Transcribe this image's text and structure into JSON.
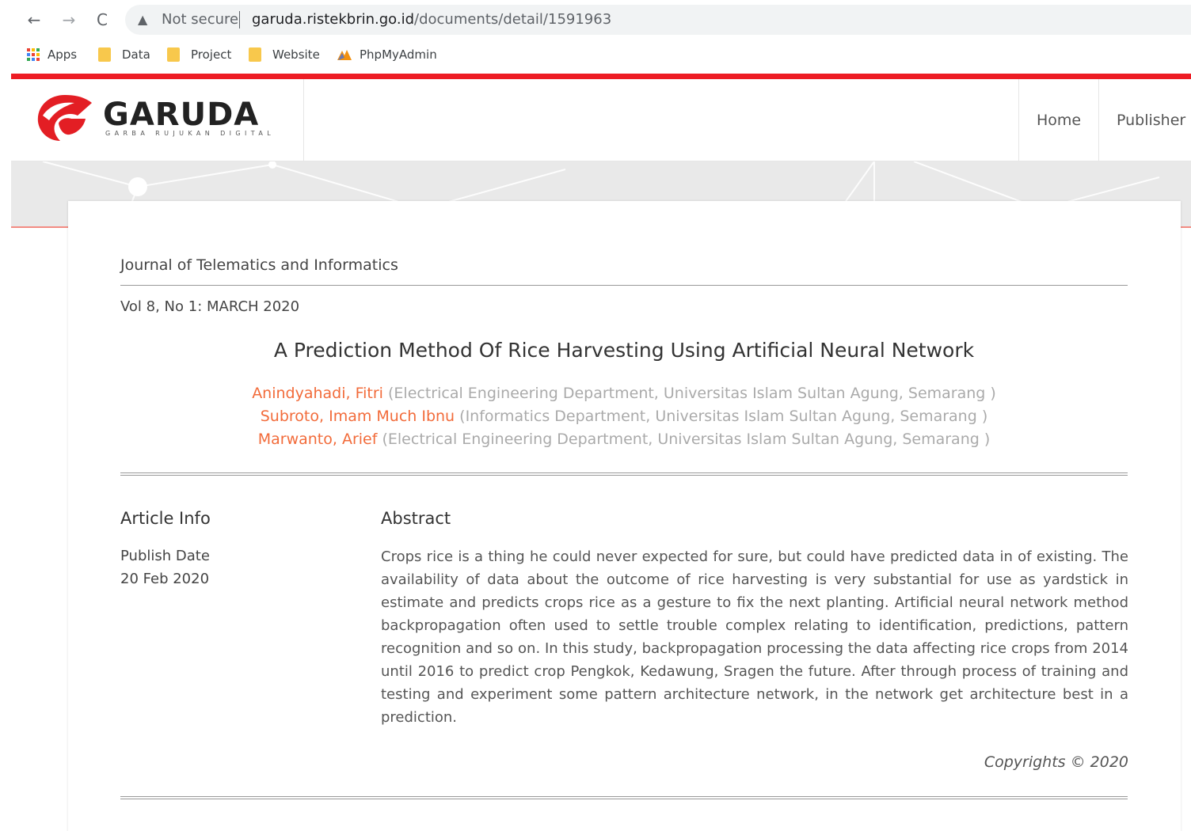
{
  "browser": {
    "back_glyph": "←",
    "forward_glyph": "→",
    "reload_glyph": "C",
    "warning_glyph": "▲",
    "security_text": "Not secure",
    "url_host": "garuda.ristekbrin.go.id",
    "url_path": "/documents/detail/1591963",
    "bookmarks": [
      "Apps",
      "Data",
      "Project",
      "Website",
      "PhpMyAdmin"
    ]
  },
  "site": {
    "logo_text": "GARUDA",
    "logo_subtitle": "GARBA RUJUKAN DIGITAL",
    "nav": [
      "Home",
      "Publisher"
    ],
    "accent_color": "#ed1c24"
  },
  "article": {
    "journal": "Journal of Telematics and Informatics",
    "volume": "Vol 8, No 1: MARCH 2020",
    "title": "A Prediction Method Of Rice Harvesting Using Artificial Neural Network",
    "authors": [
      {
        "name": "Anindyahadi, Fitri",
        "affiliation": "(Electrical Engineering Department, Universitas Islam Sultan Agung, Semarang )"
      },
      {
        "name": "Subroto, Imam Much Ibnu",
        "affiliation": "(Informatics Department, Universitas Islam Sultan Agung, Semarang )"
      },
      {
        "name": "Marwanto, Arief",
        "affiliation": "(Electrical Engineering Department, Universitas Islam Sultan Agung, Semarang )"
      }
    ],
    "info_heading": "Article Info",
    "publish_label": "Publish Date",
    "publish_date": "20 Feb 2020",
    "abstract_heading": "Abstract",
    "abstract": "Crops rice is a thing he could never expected for sure, but could have predicted data in of existing. The availability of data about the outcome of rice harvesting is very substantial for use as yardstick in estimate and predicts crops rice as a gesture to fix the next planting. Artificial neural network method backpropagation often used to settle trouble complex relating to identification, predictions, pattern recognition and so on. In this study, backpropagation processing the data affecting rice crops from 2014 until 2016 to predict crop Pengkok, Kedawung, Sragen the future. After through process of training and testing and experiment some pattern architecture network, in the network get architecture best in a prediction.",
    "copyright": "Copyrights © 2020"
  }
}
